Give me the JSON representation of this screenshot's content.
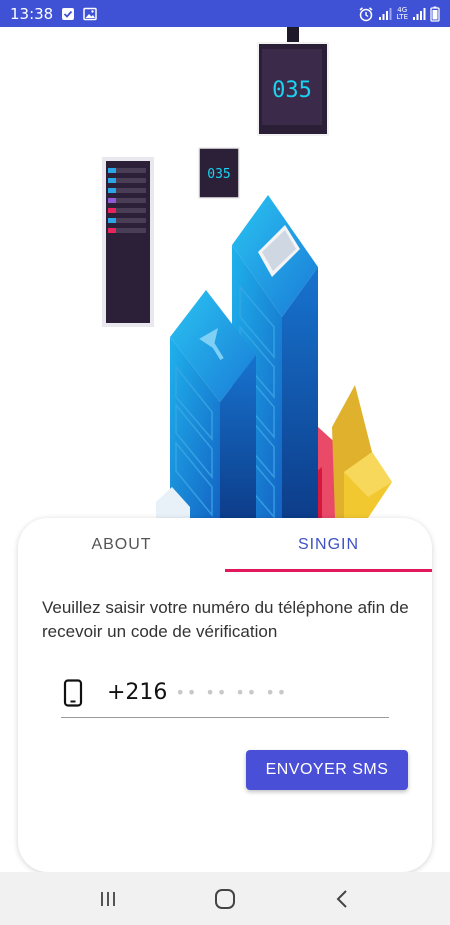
{
  "status_bar": {
    "time": "13:38",
    "network_label_top": "4G",
    "network_label_bottom": "LTE",
    "icons": [
      "check-notification-icon",
      "image-notification-icon",
      "alarm-icon",
      "signal-icon",
      "signal-icon",
      "battery-icon"
    ]
  },
  "illustration": {
    "panel_time_label": "035",
    "card_time_label": "035"
  },
  "tabs": {
    "about_label": "ABOUT",
    "signin_label": "SINGIN",
    "active": "SINGIN"
  },
  "form": {
    "description": "Veuillez saisir votre numéro du téléphone afin de recevoir un code de vérification",
    "country_code": "+216",
    "phone_placeholder": "•• •• •• ••",
    "phone_value": "",
    "send_label": "ENVOYER SMS"
  },
  "nav_bar": {
    "icons": [
      "recent-apps-icon",
      "home-icon",
      "back-icon"
    ]
  },
  "colors": {
    "status_bar": "#3f51d4",
    "accent": "#4a4fd8",
    "tab_indicator": "#e2185c"
  }
}
